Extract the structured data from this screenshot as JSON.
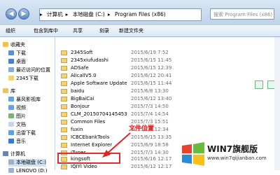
{
  "address": {
    "segments": [
      "计算机",
      "本地磁盘 (C:)",
      "Program Files (x86)"
    ],
    "search_placeholder": "搜索 Program Files (x86)"
  },
  "toolbar": {
    "organize": "组织",
    "include_library": "包含到库中",
    "share": "共享",
    "burn": "刻录",
    "new_folder": "新建文件夹"
  },
  "sidebar": {
    "favorites": "收藏夹",
    "items": [
      "下载",
      "桌面",
      "最近访问的位置",
      "2345下载"
    ],
    "library": "库",
    "library_items": [
      "暴风影视库",
      "视频",
      "图片",
      "文档",
      "迅雷下载",
      "音乐"
    ],
    "computer": "计算机",
    "computer_items": [
      "本地磁盘 (C:)",
      "LENOVO (D:)"
    ]
  },
  "files": [
    {
      "name": "2345Soft",
      "date": "2015/6/19 7:52"
    },
    {
      "name": "2345xiufudashi",
      "date": "2015/6/15 11:45"
    },
    {
      "name": "ADSafe",
      "date": "2015/6/15 12:39"
    },
    {
      "name": "AlicallV5.0",
      "date": "2015/6/12 20:41"
    },
    {
      "name": "Apple Software Update",
      "date": "2015/6/15 11:44"
    },
    {
      "name": "baidu",
      "date": "2015/6/8 13:30"
    },
    {
      "name": "BigBaiCai",
      "date": "2015/6/12 13:40"
    },
    {
      "name": "Bonjour",
      "date": "2015/7/3 14:50"
    },
    {
      "name": "CLM_20150704145453",
      "date": "2015/7/4 14:54"
    },
    {
      "name": "Common Files",
      "date": "2015/7/3 15:51"
    },
    {
      "name": "fuxin",
      "date": "2015/7/4 12:34"
    },
    {
      "name": "ICBCEbankTools",
      "date": "2015/6/15 13:35"
    },
    {
      "name": "Internet Explorer",
      "date": "2015/6/9 18:58"
    },
    {
      "name": "iTunes",
      "date": "2015/7/3 14:30"
    },
    {
      "name": "kingsoft",
      "date": "2015/6/16 12:17"
    },
    {
      "name": "IQIYI Video",
      "date": "2015/6/12 12:17"
    }
  ],
  "annotation": "文件位置",
  "watermark": {
    "title": "WIN7旗舰版",
    "url": "www.win7qijianban.com"
  },
  "colors": {
    "highlight": "#e52b2b",
    "folder": "#f3d272"
  }
}
